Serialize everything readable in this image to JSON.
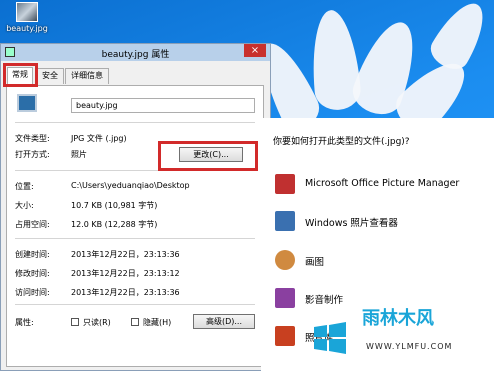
{
  "desktop": {
    "icon_label": "beauty.jpg"
  },
  "dialog": {
    "title": "beauty.jpg 属性",
    "close_glyph": "×",
    "tabs": [
      "常规",
      "安全",
      "详细信息"
    ],
    "filename": "beauty.jpg",
    "rows": {
      "filetype": {
        "label": "文件类型:",
        "value": "JPG 文件 (.jpg)"
      },
      "openwith": {
        "label": "打开方式:",
        "value": "照片"
      },
      "location": {
        "label": "位置:",
        "value": "C:\\Users\\yeduanqiao\\Desktop"
      },
      "size": {
        "label": "大小:",
        "value": "10.7 KB (10,981 字节)"
      },
      "disksize": {
        "label": "占用空间:",
        "value": "12.0 KB (12,288 字节)"
      },
      "created": {
        "label": "创建时间:",
        "value": "2013年12月22日，23:13:36"
      },
      "modified": {
        "label": "修改时间:",
        "value": "2013年12月22日，23:13:12"
      },
      "accessed": {
        "label": "访问时间:",
        "value": "2013年12月22日，23:13:36"
      },
      "attributes": {
        "label": "属性:"
      }
    },
    "change_button": "更改(C)...",
    "readonly_label": "只读(R)",
    "hidden_label": "隐藏(H)",
    "advanced_button": "高级(D)..."
  },
  "chooser": {
    "question": "你要如何打开此类型的文件(.jpg)?",
    "apps": [
      {
        "name": "Microsoft Office Picture Manager",
        "icon": "picture-manager-icon",
        "color": "#c03030"
      },
      {
        "name": "Windows 照片查看器",
        "icon": "photo-viewer-icon",
        "color": "#3a70b0"
      },
      {
        "name": "画图",
        "icon": "paint-icon",
        "color": "#d08a40"
      },
      {
        "name": "影音制作",
        "icon": "movie-maker-icon",
        "color": "#8a40a0"
      },
      {
        "name": "照片库",
        "icon": "photo-gallery-icon",
        "color": "#c84020"
      }
    ]
  },
  "watermark": {
    "title": "雨林木风",
    "url": "WWW.YLMFU.COM"
  },
  "colors": {
    "highlight": "#d22a2a",
    "titlebar": "#b8d0ea"
  }
}
